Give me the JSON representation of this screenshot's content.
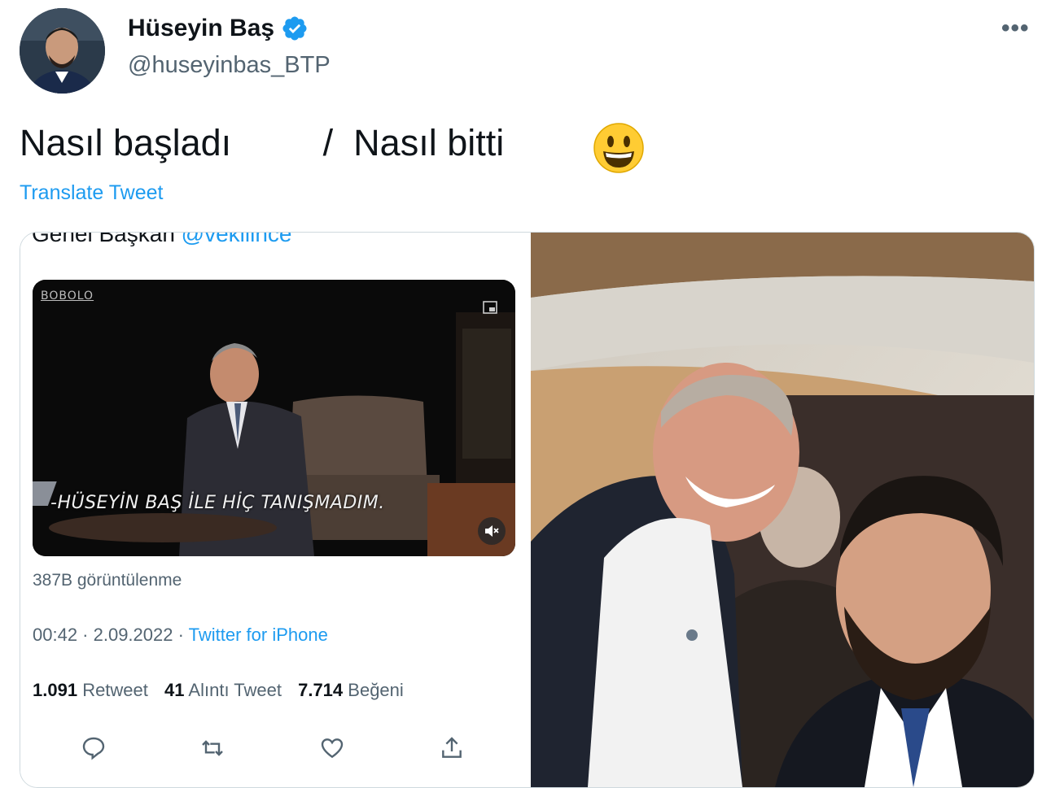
{
  "author": {
    "name": "Hüseyin Baş",
    "handle": "@huseyinbas_BTP",
    "verified_icon": "verified-badge-icon",
    "more_label": "•••"
  },
  "tweet": {
    "text": "Nasıl başladı         /  Nasıl bitti",
    "emoji_icon": "grinning-face-emoji",
    "translate_label": "Translate Tweet"
  },
  "embedded": {
    "cut_text_prefix": "Genel Başkan ",
    "cut_text_mention": "@vekilince",
    "video_brand": "BOBOLO",
    "video_subtitle": "-HÜSEYİN BAŞ İLE HİÇ TANIŞMADIM.",
    "views": "387B görüntülenme",
    "time": "00:42 · 2.09.2022 · ",
    "source": "Twitter for iPhone",
    "retweets_count": "1.091",
    "retweets_label": "Retweet",
    "quotes_count": "41",
    "quotes_label": "Alıntı Tweet",
    "likes_count": "7.714",
    "likes_label": "Beğeni"
  },
  "colors": {
    "accent": "#1d9bf0",
    "secondary_text": "#536471",
    "primary_text": "#0f1419"
  }
}
